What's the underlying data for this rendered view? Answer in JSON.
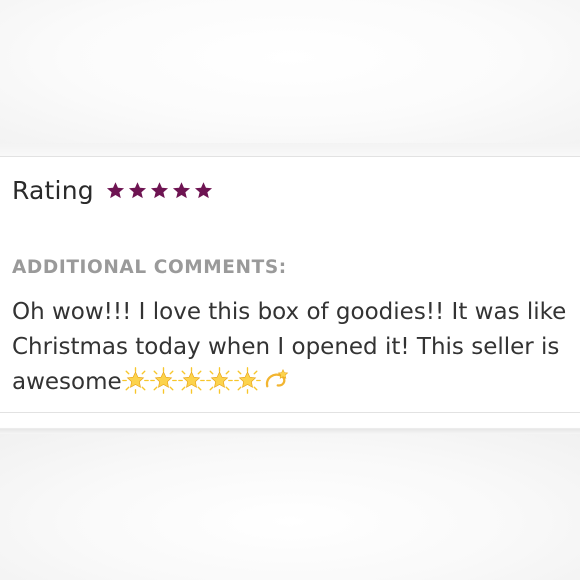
{
  "review": {
    "rating_label": "Rating",
    "rating_value": 5,
    "rating_max": 5,
    "comments_heading": "ADDITIONAL COMMENTS:",
    "comment_text": "Oh wow!!! I love this box of goodies!! It was like Christmas today when I opened it! This seller is awesome",
    "comment_emojis": [
      "glowing-star",
      "glowing-star",
      "glowing-star",
      "glowing-star",
      "glowing-star",
      "dizzy"
    ]
  },
  "colors": {
    "star_color": "#6e1452",
    "heading_gray": "#9a9a9a",
    "text_dark": "#333333"
  },
  "icons": {
    "rating_star": "star-icon",
    "emoji_star": "glowing-star-emoji",
    "emoji_dizzy": "dizzy-emoji"
  }
}
